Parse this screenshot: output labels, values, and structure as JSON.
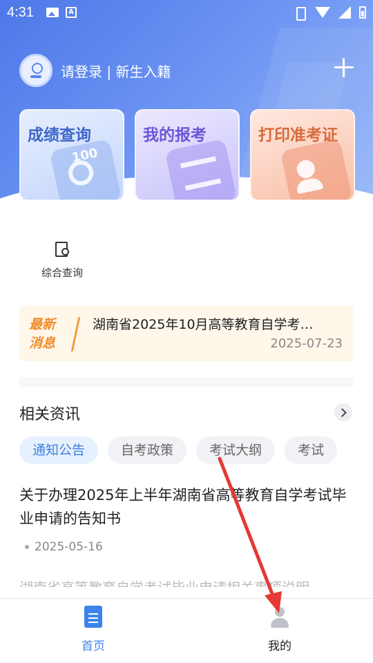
{
  "status_bar": {
    "time": "4:31",
    "icons_left": [
      "image-icon",
      "font-icon"
    ],
    "icons_right": [
      "vibrate-icon",
      "wifi-icon",
      "signal-icon",
      "battery-icon"
    ]
  },
  "header": {
    "login_text": "请登录 | 新生入籍",
    "add_icon": "plus-icon"
  },
  "cards": [
    {
      "label": "成绩查询",
      "icon": "score-icon",
      "color": "#3d66c9"
    },
    {
      "label": "我的报考",
      "icon": "register-icon",
      "color": "#6a57d6"
    },
    {
      "label": "打印准考证",
      "icon": "admission-card-icon",
      "color": "#d86a3c"
    }
  ],
  "card_art": {
    "score_mark": "100"
  },
  "quick_links": [
    {
      "label": "综合查询",
      "icon": "search-doc-icon"
    }
  ],
  "news": {
    "badge_line1": "最新",
    "badge_line2": "消息",
    "title": "湖南省2025年10月高等教育自学考…",
    "date": "2025-07-23"
  },
  "section": {
    "title": "相关资讯",
    "tabs": [
      {
        "label": "通知公告",
        "active": true
      },
      {
        "label": "自考政策",
        "active": false
      },
      {
        "label": "考试大纲",
        "active": false
      },
      {
        "label": "考试",
        "active": false
      }
    ]
  },
  "article": {
    "title": "关于办理2025年上半年湖南省高等教育自学考试毕业申请的告知书",
    "date": "2025-05-16",
    "excerpt": "湖南省高等教育自学考试毕业申请相关事项说明"
  },
  "bottom_nav": [
    {
      "label": "首页",
      "icon": "home-doc-icon",
      "active": true
    },
    {
      "label": "我的",
      "icon": "user-icon",
      "active": false
    }
  ],
  "colors": {
    "primary": "#3d84ea",
    "hero_start": "#4e78e8",
    "news_bg": "#fff7ea",
    "news_accent": "#f08c2a",
    "annotation_arrow": "#e53935"
  }
}
